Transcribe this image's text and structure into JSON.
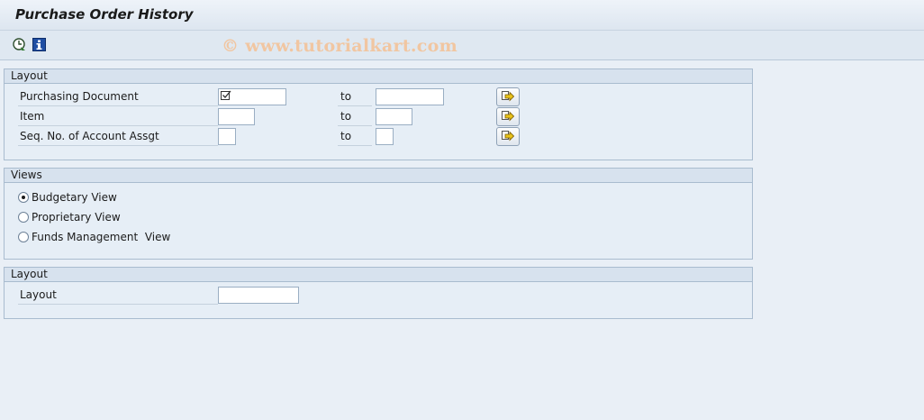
{
  "window": {
    "title": "Purchase Order History"
  },
  "toolbar": {
    "icons": [
      "execute-clock-icon",
      "info-icon"
    ],
    "watermark": "© www.tutorialkart.com"
  },
  "selection_group": {
    "header": "Layout",
    "rows": [
      {
        "label": "Purchasing Document",
        "to_label": "to",
        "from_value": "",
        "to_value": "",
        "from_checked": true,
        "button_icon": "multiple-selection-arrow-icon"
      },
      {
        "label": "Item",
        "to_label": "to",
        "from_value": "",
        "to_value": "",
        "button_icon": "multiple-selection-arrow-icon"
      },
      {
        "label": "Seq. No. of Account Assgt",
        "to_label": "to",
        "from_value": "",
        "to_value": "",
        "button_icon": "multiple-selection-arrow-icon"
      }
    ]
  },
  "views_group": {
    "header": "Views",
    "options": [
      {
        "label": "Budgetary View",
        "selected": true
      },
      {
        "label": "Proprietary View",
        "selected": false
      },
      {
        "label": "Funds Management  View",
        "selected": false
      }
    ]
  },
  "layout_group": {
    "header": "Layout",
    "field_label": "Layout",
    "field_value": ""
  },
  "colors": {
    "background": "#e9eff6",
    "group_header": "#d7e2ee",
    "border": "#a9bccf",
    "button_arrow": "#e8c21a"
  }
}
